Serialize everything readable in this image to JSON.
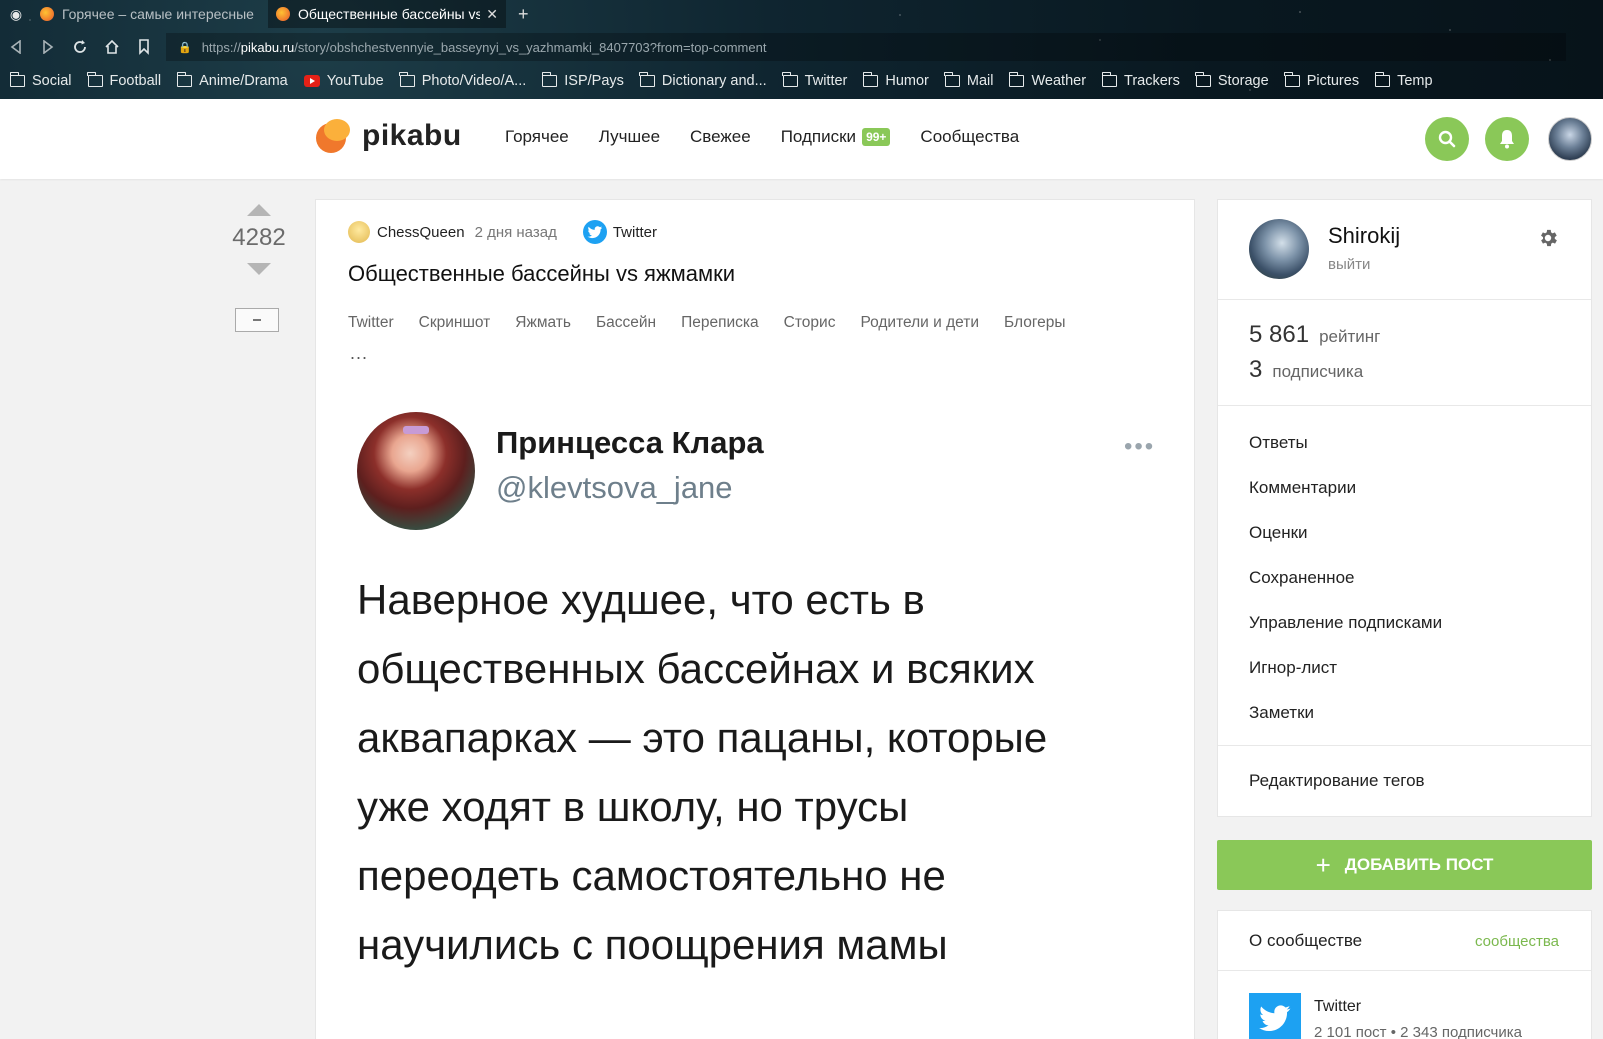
{
  "browser": {
    "tabs": [
      {
        "title": "Горячее – самые интересные"
      },
      {
        "title": "Общественные бассейны vs"
      }
    ],
    "url_prefix": "https://",
    "url_domain": "pikabu.ru",
    "url_path": "/story/obshchestvennyie_basseynyi_vs_yazhmamki_8407703?from=top-comment",
    "bookmarks": [
      {
        "label": "Social",
        "icon": "folder-icon"
      },
      {
        "label": "Football",
        "icon": "folder-icon"
      },
      {
        "label": "Anime/Drama",
        "icon": "folder-icon"
      },
      {
        "label": "YouTube",
        "icon": "youtube-icon"
      },
      {
        "label": "Photo/Video/A...",
        "icon": "folder-icon"
      },
      {
        "label": "ISP/Pays",
        "icon": "folder-icon"
      },
      {
        "label": "Dictionary and...",
        "icon": "folder-icon"
      },
      {
        "label": "Twitter",
        "icon": "folder-icon"
      },
      {
        "label": "Humor",
        "icon": "folder-icon"
      },
      {
        "label": "Mail",
        "icon": "folder-icon"
      },
      {
        "label": "Weather",
        "icon": "folder-icon"
      },
      {
        "label": "Trackers",
        "icon": "folder-icon"
      },
      {
        "label": "Storage",
        "icon": "folder-icon"
      },
      {
        "label": "Pictures",
        "icon": "folder-icon"
      },
      {
        "label": "Temp",
        "icon": "folder-icon"
      }
    ]
  },
  "header": {
    "logo_text": "pikabu",
    "nav": {
      "hot": "Горячее",
      "best": "Лучшее",
      "fresh": "Свежее",
      "subs": "Подписки",
      "subs_badge": "99+",
      "communities": "Сообщества"
    },
    "accent_color": "#8ac858"
  },
  "story": {
    "rating": "4282",
    "author": "ChessQueen",
    "time": "2 дня назад",
    "community": "Twitter",
    "title": "Общественные бассейны vs яжмамки",
    "tags": [
      "Twitter",
      "Скриншот",
      "Яжмать",
      "Бассейн",
      "Переписка",
      "Сторис",
      "Родители и дети",
      "Блогеры"
    ],
    "tags_more": "...",
    "tweet": {
      "name": "Принцесса Клара",
      "handle": "@klevtsova_jane",
      "menu": "•••",
      "lines": [
        "Наверное худшее, что есть в",
        "общественных бассейнах и всяких",
        "аквапарках — это пацаны, которые",
        "уже ходят в школу, но трусы",
        "переодеть самостоятельно не",
        "научились с поощрения мамы"
      ]
    }
  },
  "sidebar": {
    "username": "Shirokij",
    "logout": "выйти",
    "rating_value": "5 861",
    "rating_label": "рейтинг",
    "subscribers_value": "3",
    "subscribers_label": "подписчика",
    "menu": [
      "Ответы",
      "Комментарии",
      "Оценки",
      "Сохраненное",
      "Управление подписками",
      "Игнор-лист",
      "Заметки"
    ],
    "edit_tags": "Редактирование тегов",
    "add_post": "ДОБАВИТЬ ПОСТ",
    "about_title": "О сообществе",
    "about_link": "сообщества",
    "community_name": "Twitter",
    "community_stats": "2 101 пост  •  2 343 подписчика"
  }
}
